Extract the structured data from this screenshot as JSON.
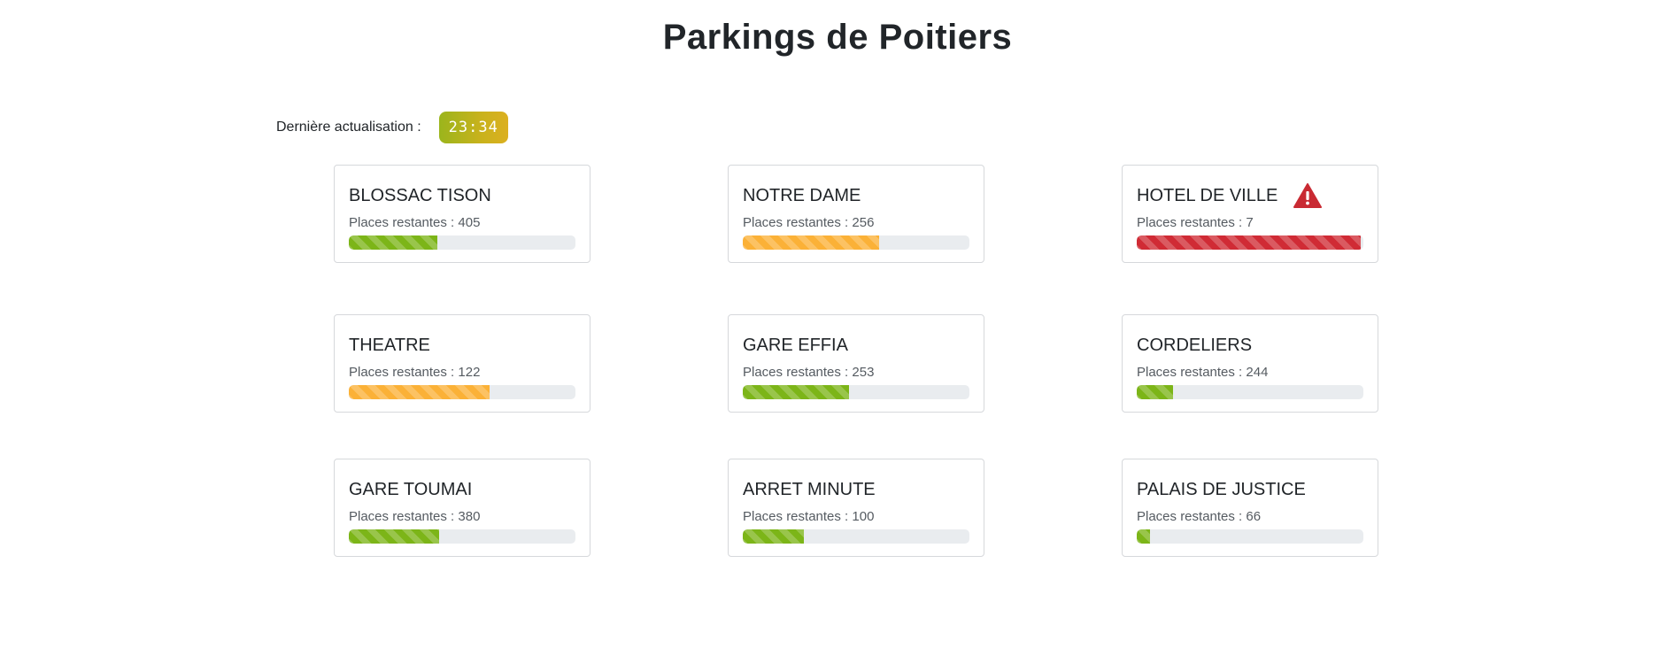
{
  "page": {
    "title": "Parkings de Poitiers"
  },
  "update": {
    "label": "Dernière actualisation :",
    "time": "23:34"
  },
  "colors": {
    "green": "#7cb518",
    "orange": "#fbb137",
    "red": "#d02b35",
    "track": "#e9ecef"
  },
  "parkings": [
    {
      "name": "BLOSSAC TISON",
      "places_text": "Places restantes : 405",
      "fill_percent": 39,
      "status": "green",
      "alert": false
    },
    {
      "name": "NOTRE DAME",
      "places_text": "Places restantes : 256",
      "fill_percent": 60,
      "status": "orange",
      "alert": false
    },
    {
      "name": "HOTEL DE VILLE",
      "places_text": "Places restantes : 7",
      "fill_percent": 99,
      "status": "red",
      "alert": true,
      "alert_icon": "warning-triangle-icon"
    },
    {
      "name": "THEATRE",
      "places_text": "Places restantes : 122",
      "fill_percent": 62,
      "status": "orange",
      "alert": false
    },
    {
      "name": "GARE EFFIA",
      "places_text": "Places restantes : 253",
      "fill_percent": 47,
      "status": "green",
      "alert": false
    },
    {
      "name": "CORDELIERS",
      "places_text": "Places restantes : 244",
      "fill_percent": 16,
      "status": "green",
      "alert": false
    },
    {
      "name": "GARE TOUMAI",
      "places_text": "Places restantes : 380",
      "fill_percent": 40,
      "status": "green",
      "alert": false
    },
    {
      "name": "ARRET MINUTE",
      "places_text": "Places restantes : 100",
      "fill_percent": 27,
      "status": "green",
      "alert": false
    },
    {
      "name": "PALAIS DE JUSTICE",
      "places_text": "Places restantes : 66",
      "fill_percent": 6,
      "status": "green",
      "alert": false
    }
  ]
}
